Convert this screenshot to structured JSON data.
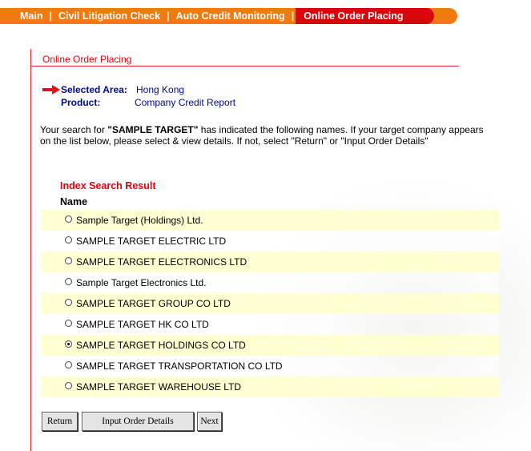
{
  "nav": {
    "items": [
      {
        "label": "Main"
      },
      {
        "label": "Civil Litigation Check"
      },
      {
        "label": "Auto Credit Monitoring"
      },
      {
        "label": "Online Order Placing",
        "active": true
      }
    ],
    "separator": "|"
  },
  "section_title": "Online Order Placing",
  "selection": {
    "area_label": "Selected Area:",
    "area_value": "Hong Kong",
    "product_label": "Product:",
    "product_value": "Company Credit Report"
  },
  "intro": {
    "prefix": "Your search for ",
    "query": "\"SAMPLE TARGET\"",
    "suffix": " has indicated the following names. If your target company appears on the list below, please select & view details. If not, select \"Return\" or \"Input Order Details\""
  },
  "results": {
    "title": "Index Search Result",
    "column_header": "Name",
    "selected_index": 6,
    "items": [
      "Sample Target (Holdings) Ltd.",
      "SAMPLE TARGET ELECTRIC LTD",
      "SAMPLE TARGET ELECTRONICS LTD",
      "Sample Target Electronics Ltd.",
      "SAMPLE TARGET GROUP CO LTD",
      "SAMPLE TARGET HK CO LTD",
      "SAMPLE TARGET HOLDINGS CO LTD",
      "SAMPLE TARGET TRANSPORTATION CO LTD",
      "SAMPLE TARGET WAREHOUSE LTD"
    ]
  },
  "buttons": {
    "return_label": "Return",
    "input_order_label": "Input Order Details",
    "next_label": "Next"
  },
  "colors": {
    "nav_orange": "#f07a12",
    "nav_active_red": "#d9070c",
    "accent_red": "#d9070c",
    "label_blue": "#000b8a",
    "row_highlight": "#ffffcd"
  }
}
